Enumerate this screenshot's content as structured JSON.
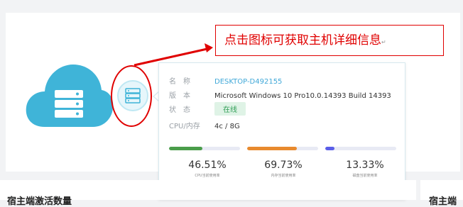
{
  "callout": {
    "text": "点击图标可获取主机详细信息"
  },
  "host_info": {
    "name_label": "名　称",
    "name_value": "DESKTOP-D492155",
    "version_label": "版　本",
    "version_value": "Microsoft Windows 10 Pro10.0.14393 Build 14393",
    "status_label": "状　态",
    "status_value": "在线",
    "cpu_mem_label": "CPU/内存",
    "cpu_mem_value": "4c / 8G"
  },
  "metrics": [
    {
      "percent": "46.51%",
      "caption": "CPU当前使用率",
      "fill": 0.4651,
      "color": "#4a9d4a"
    },
    {
      "percent": "69.73%",
      "caption": "内存当前使用率",
      "fill": 0.6973,
      "color": "#e88a2e"
    },
    {
      "percent": "13.33%",
      "caption": "磁盘当前使用率",
      "fill": 0.1333,
      "color": "#5a5ee8"
    }
  ],
  "bottom": {
    "left_title": "宿主端激活数量",
    "right_title": "宿主端"
  },
  "colors": {
    "cloud": "#3fb4d8",
    "alert": "#e00000"
  },
  "icons": [
    "cloud-server-icon",
    "server-icon"
  ]
}
